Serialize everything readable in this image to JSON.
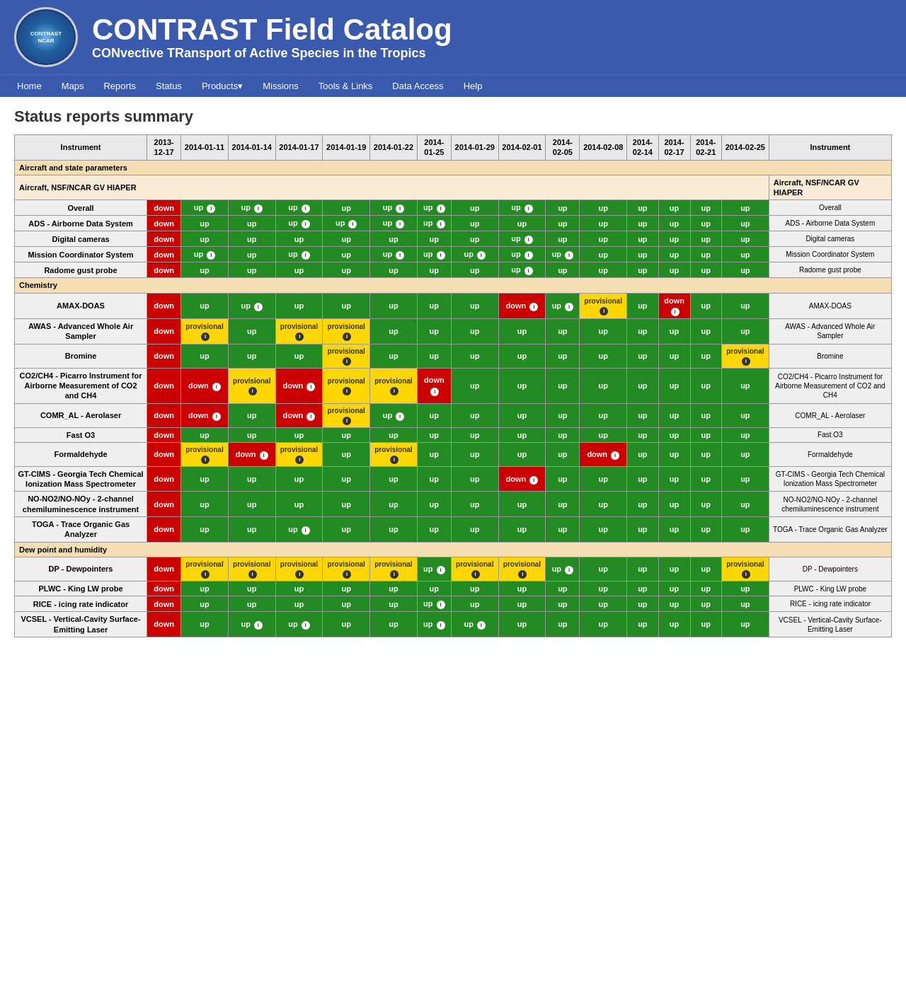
{
  "header": {
    "title": "CONTRAST Field Catalog",
    "subtitle": "CONvective TRansport of Active Species in the Tropics",
    "logo_text": "CONTRAST NCAR"
  },
  "nav": {
    "items": [
      {
        "label": "Home",
        "href": "#"
      },
      {
        "label": "Maps",
        "href": "#"
      },
      {
        "label": "Reports",
        "href": "#"
      },
      {
        "label": "Status",
        "href": "#"
      },
      {
        "label": "Products",
        "href": "#",
        "has_dropdown": true
      },
      {
        "label": "Missions",
        "href": "#"
      },
      {
        "label": "Tools & Links",
        "href": "#"
      },
      {
        "label": "Data Access",
        "href": "#"
      },
      {
        "label": "Help",
        "href": "#"
      }
    ]
  },
  "page": {
    "title": "Status reports summary"
  },
  "table": {
    "dates": [
      "2013-12-17",
      "2014-01-11",
      "2014-01-14",
      "2014-01-17",
      "2014-01-19",
      "2014-01-22",
      "2014-01-25",
      "2014-01-29",
      "2014-02-01",
      "2014-02-05",
      "2014-02-08",
      "2014-02-14",
      "2014-02-17",
      "2014-02-21",
      "2014-02-25"
    ],
    "instrument_col": "Instrument"
  }
}
